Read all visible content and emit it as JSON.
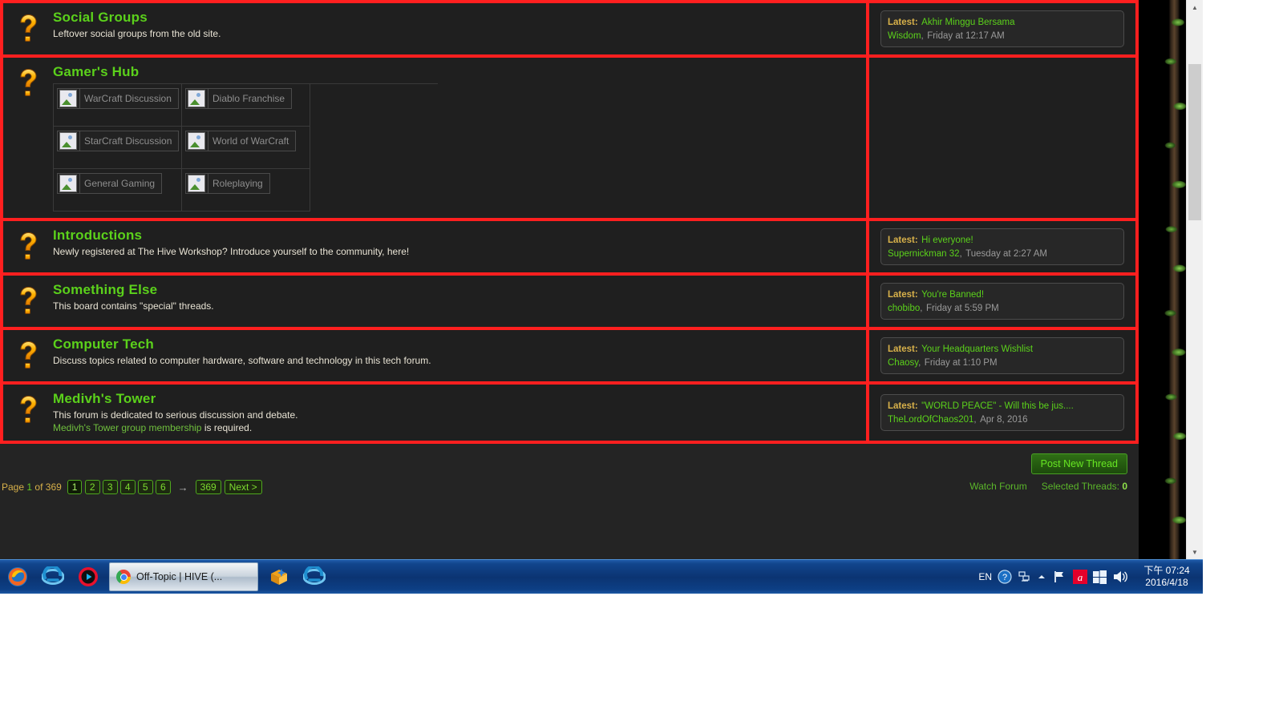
{
  "colors": {
    "highlight_border": "#ff1f1f",
    "title_green": "#5bd11b",
    "latest_label": "#d8b14a",
    "page_bg": "#242424",
    "row_bg": "#1f1f1f"
  },
  "forums": [
    {
      "icon": "question-mark-icon",
      "title": "Social Groups",
      "description": "Leftover social groups from the old site.",
      "subforums": [],
      "latest": {
        "label": "Latest:",
        "thread": "Akhir Minggu Bersama",
        "user": "Wisdom",
        "separator": ",",
        "date": "Friday at 12:17 AM"
      }
    },
    {
      "icon": "question-mark-icon",
      "title": "Gamer's Hub",
      "description": "",
      "subforums": [
        "WarCraft Discussion",
        "Diablo Franchise",
        "StarCraft Discussion",
        "World of WarCraft",
        "General Gaming",
        "Roleplaying"
      ],
      "latest": null
    },
    {
      "icon": "question-mark-icon",
      "title": "Introductions",
      "description": "Newly registered at The Hive Workshop? Introduce yourself to the community, here!",
      "subforums": [],
      "latest": {
        "label": "Latest:",
        "thread": "Hi everyone!",
        "user": "Supernickman 32",
        "separator": ",",
        "date": "Tuesday at 2:27 AM"
      }
    },
    {
      "icon": "question-mark-icon",
      "title": "Something Else",
      "description": "This board contains \"special\" threads.",
      "subforums": [],
      "latest": {
        "label": "Latest:",
        "thread": "You're Banned!",
        "user": "chobibo",
        "separator": ",",
        "date": "Friday at 5:59 PM"
      }
    },
    {
      "icon": "question-mark-icon",
      "title": "Computer Tech",
      "description": "Discuss topics related to computer hardware, software and technology in this tech forum.",
      "subforums": [],
      "latest": {
        "label": "Latest:",
        "thread": "Your Headquarters Wishlist",
        "user": "Chaosy",
        "separator": ",",
        "date": "Friday at 1:10 PM"
      }
    },
    {
      "icon": "question-mark-icon",
      "title": "Medivh's Tower",
      "description": "This forum is dedicated to serious discussion and debate.",
      "description_line2_link": "Medivh's Tower group membership",
      "description_line2_rest": " is required.",
      "subforums": [],
      "latest": {
        "label": "Latest:",
        "thread": "\"WORLD PEACE\" - Will this be jus....",
        "user": "TheLordOfChaos201",
        "separator": ",",
        "date": "Apr 8, 2016"
      }
    }
  ],
  "bottom_bar": {
    "post_new_thread_label": "Post New Thread",
    "page_prefix": "Page",
    "page_current": "1",
    "page_of": "of",
    "page_total": "369",
    "pages": [
      "1",
      "2",
      "3",
      "4",
      "5",
      "6"
    ],
    "arrow_glyph": "→",
    "last_page": "369",
    "next_label": "Next >",
    "watch_forum_label": "Watch Forum",
    "selected_threads_label": "Selected Threads:",
    "selected_threads_count": "0"
  },
  "taskbar": {
    "items": [
      {
        "name": "firefox-icon",
        "label": "Mozilla Firefox"
      },
      {
        "name": "internet-explorer-icon",
        "label": "Internet Explorer"
      },
      {
        "name": "media-player-icon",
        "label": "Media Player"
      }
    ],
    "active_window": {
      "icon": "chrome-icon",
      "title": "Off-Topic | HIVE (..."
    },
    "items_after": [
      {
        "name": "package-icon",
        "label": "Installer"
      },
      {
        "name": "internet-explorer-icon",
        "label": "Internet Explorer"
      }
    ],
    "tray": {
      "language": "EN",
      "help_icon": "help-icon",
      "network_icon": "network-icon",
      "show_hidden_icon": "show-hidden-icons-icon",
      "flag_icon": "action-center-flag-icon",
      "antivirus_icon": "avira-antivirus-icon",
      "windows_icon": "windows-icon",
      "volume_icon": "volume-icon",
      "clock_time": "下午 07:24",
      "clock_date": "2016/4/18"
    }
  },
  "scrollbar": {
    "up_glyph": "▲",
    "down_glyph": "▼"
  }
}
